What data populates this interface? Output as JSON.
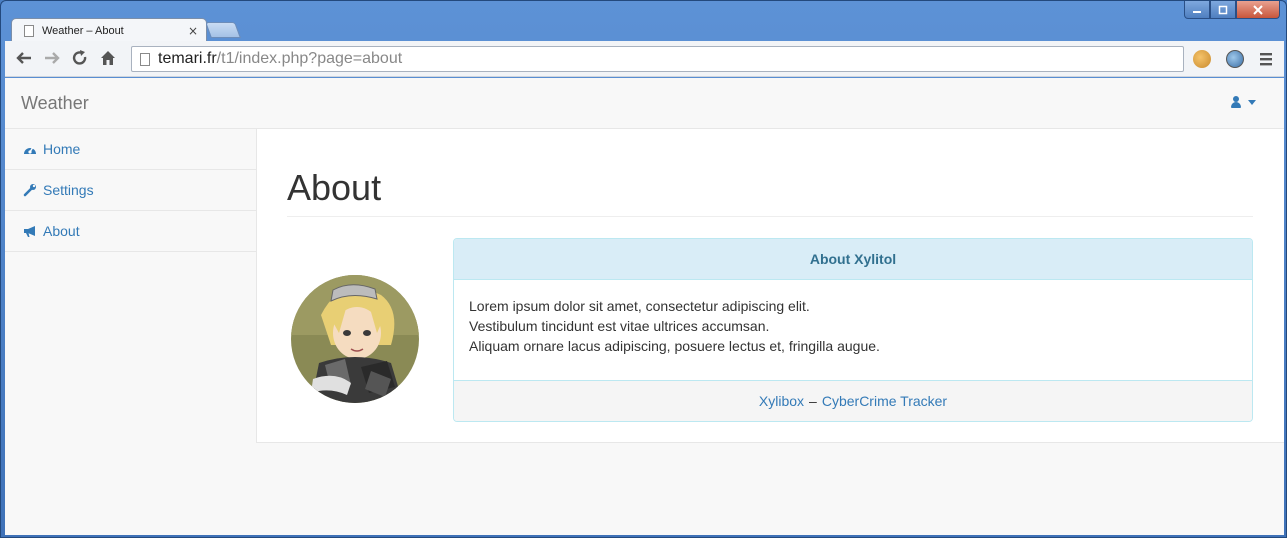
{
  "browser": {
    "tab_title": "Weather – About",
    "tab_close": "×",
    "url_host": "temari.fr",
    "url_path": "/t1/index.php?page=about"
  },
  "navbar": {
    "brand": "Weather"
  },
  "sidebar": {
    "items": [
      {
        "label": "Home",
        "icon": "dashboard-icon"
      },
      {
        "label": "Settings",
        "icon": "wrench-icon"
      },
      {
        "label": "About",
        "icon": "bullhorn-icon"
      }
    ]
  },
  "main": {
    "title": "About",
    "panel": {
      "heading": "About Xylitol",
      "lines": [
        "Lorem ipsum dolor sit amet, consectetur adipiscing elit.",
        "Vestibulum tincidunt est vitae ultrices accumsan.",
        "Aliquam ornare lacus adipiscing, posuere lectus et, fringilla augue."
      ],
      "footer": {
        "link1": "Xylibox",
        "separator": "–",
        "link2": "CyberCrime Tracker"
      }
    }
  },
  "colors": {
    "link": "#337ab7",
    "panel_heading_bg": "#d9edf7",
    "panel_border": "#bce8f1"
  }
}
